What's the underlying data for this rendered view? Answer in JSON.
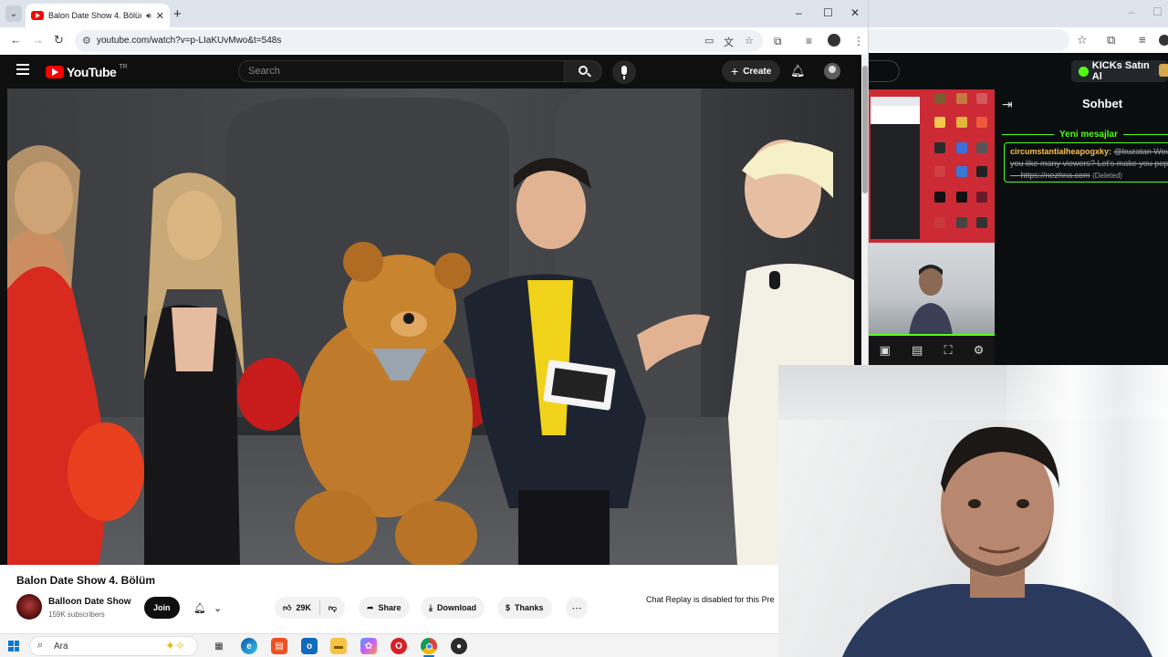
{
  "browser": {
    "tab_title": "Balon Date Show 4. Bölüm",
    "url": "youtube.com/watch?v=p-LIaKUvMwo&t=548s",
    "window_controls": {
      "minimize": "–",
      "maximize": "☐",
      "close": "✕"
    }
  },
  "youtube": {
    "logo_text": "YouTube",
    "country_code": "TR",
    "search_placeholder": "Search",
    "create_label": "Create",
    "video_title": "Balon Date Show 4. Bölüm",
    "channel_name": "Balloon Date Show",
    "subscribers": "159K subscribers",
    "join_label": "Join",
    "like_count": "29K",
    "share_label": "Share",
    "download_label": "Download",
    "thanks_label": "Thanks",
    "chat_replay_note": "Chat Replay is disabled for this Pre"
  },
  "kick": {
    "buy_label": "KICKs Satın Al",
    "chat_title": "Sohbet",
    "new_messages_label": "Yeni mesajlar",
    "message_user": "circumstantialheapogxky:",
    "message_text": "@buzatan Would you like many viewers? Let's make you popular — https://nezhna.com",
    "message_line1": "@buzatan Wou",
    "message_line2": "you like many viewers? Let's make you pop",
    "message_line3": "— https://nezhna.com",
    "message_deleted": "(Deleted)",
    "accent_color": "#53fc18"
  },
  "taskbar": {
    "search_label": "Ara",
    "apps": [
      "task-view-icon",
      "edge-icon",
      "store-icon",
      "outlook-icon",
      "file-explorer-icon",
      "copilot-icon",
      "opera-icon",
      "chrome-icon",
      "obs-icon"
    ]
  }
}
